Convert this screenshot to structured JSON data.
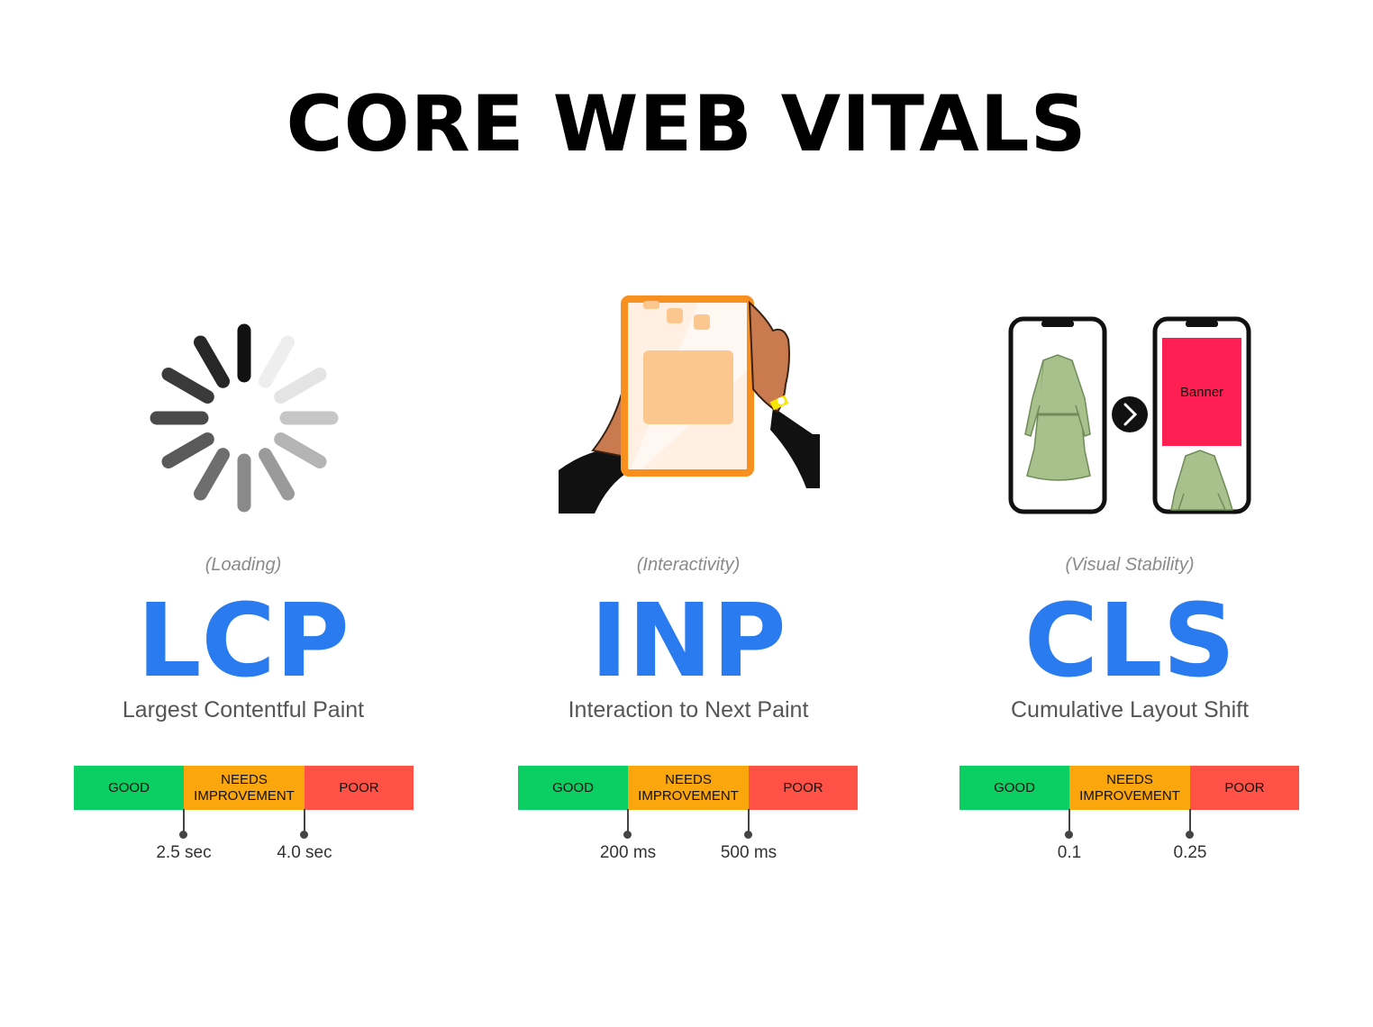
{
  "title": "CORE WEB VITALS",
  "colors": {
    "accent": "#2a7bf0",
    "good": "#0ccf63",
    "needs": "#fba60c",
    "poor": "#ff5146"
  },
  "metrics": [
    {
      "caption": "(Loading)",
      "acronym": "LCP",
      "name": "Largest Contentful Paint",
      "illustration": "loading-spinner-icon",
      "bands": [
        "GOOD",
        "NEEDS\nIMPROVEMENT",
        "POOR"
      ],
      "thresholds": [
        "2.5 sec",
        "4.0 sec"
      ]
    },
    {
      "caption": "(Interactivity)",
      "acronym": "INP",
      "name": "Interaction to Next Paint",
      "illustration": "hands-tablet-icon",
      "bands": [
        "GOOD",
        "NEEDS\nIMPROVEMENT",
        "POOR"
      ],
      "thresholds": [
        "200 ms",
        "500 ms"
      ]
    },
    {
      "caption": "(Visual Stability)",
      "acronym": "CLS",
      "name": "Cumulative Layout Shift",
      "illustration": "phones-layout-shift-icon",
      "banner_text": "Banner",
      "bands": [
        "GOOD",
        "NEEDS\nIMPROVEMENT",
        "POOR"
      ],
      "thresholds": [
        "0.1",
        "0.25"
      ]
    }
  ]
}
